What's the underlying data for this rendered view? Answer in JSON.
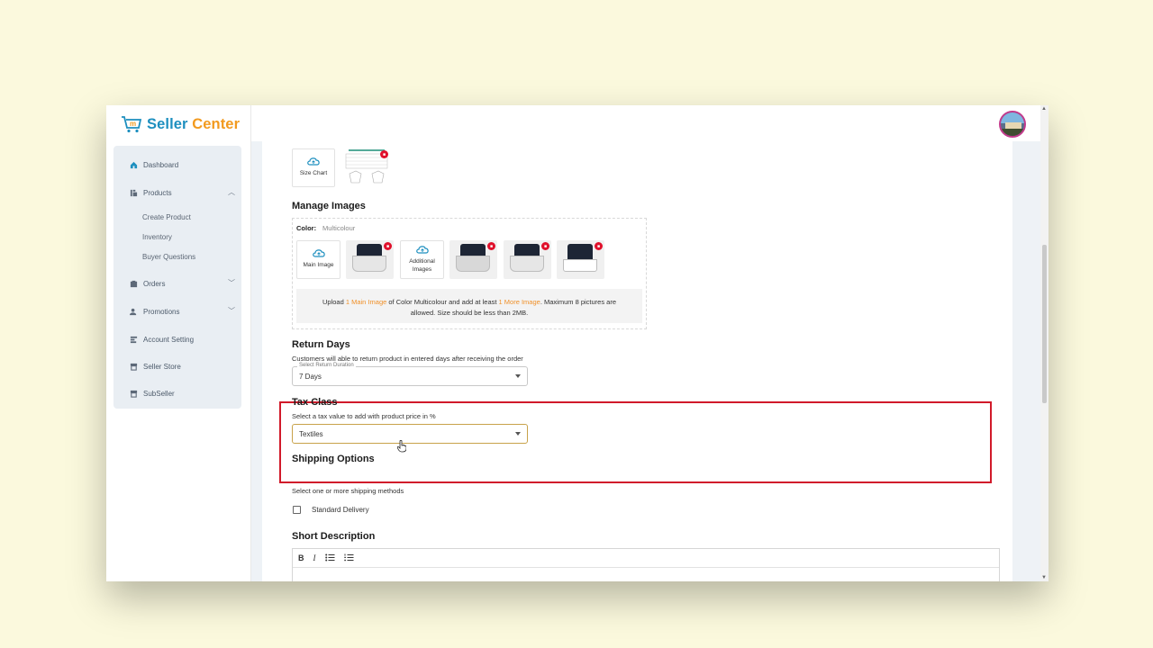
{
  "app": {
    "brand_part1": "Seller ",
    "brand_part2": "Center"
  },
  "sidebar": {
    "items": [
      {
        "label": "Dashboard",
        "icon": "home-icon"
      },
      {
        "label": "Products",
        "icon": "products-icon"
      },
      {
        "label": "Orders",
        "icon": "orders-icon"
      },
      {
        "label": "Promotions",
        "icon": "promotions-icon"
      },
      {
        "label": "Account Setting",
        "icon": "account-setting-icon"
      },
      {
        "label": "Seller Store",
        "icon": "store-icon"
      },
      {
        "label": "SubSeller",
        "icon": "subseller-icon"
      }
    ],
    "products_sub": [
      "Create Product",
      "Inventory",
      "Buyer Questions"
    ]
  },
  "size_chart": {
    "label": "Size Chart"
  },
  "manage_images": {
    "title": "Manage Images",
    "color_label": "Color:",
    "color_value": "Multicolour",
    "main_image_label": "Main Image",
    "additional_images_label": "Additional Images",
    "info": {
      "part1": "Upload ",
      "link1": "1 Main Image",
      "part2": " of Color Multicolour and add at least ",
      "link2": "1 More Image",
      "part3": ". Maximum 8 pictures are",
      "line2": "allowed. Size should be less than 2MB."
    }
  },
  "return_days": {
    "title": "Return Days",
    "description": "Customers will able to return product in entered days after receiving the order",
    "select_legend": "Select Return Duration",
    "value": "7 Days"
  },
  "tax_class": {
    "title": "Tax Class",
    "description": "Select a tax value to add with product price in %",
    "value": "Textiles"
  },
  "shipping": {
    "title": "Shipping Options",
    "description": "Select one or more shipping methods",
    "option": "Standard Delivery"
  },
  "short_description": {
    "title": "Short Description",
    "toolbar": {
      "bold": "B",
      "italic": "I",
      "bullets": "⁝≡",
      "numbers": "⁝≡"
    }
  },
  "colors": {
    "brand_blue": "#1d8fbf",
    "brand_orange": "#f29a1f",
    "highlight_red": "#d11a2a",
    "select_focus": "#c8a24a"
  }
}
